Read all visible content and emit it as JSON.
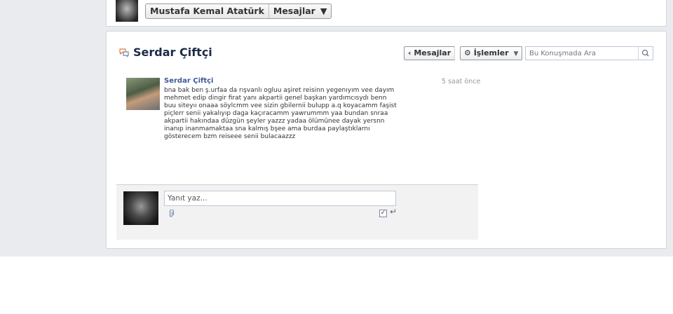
{
  "header": {
    "user_name": "Mustafa Kemal Atatürk",
    "messages_menu": "Mesajlar",
    "messages_caret": "▼"
  },
  "conversation": {
    "title": "Serdar Çiftçi",
    "back_button": "‹ Mesajlar",
    "actions_button": "⚙ İşlemler",
    "actions_caret": "▼",
    "search_placeholder": "Bu Konuşmada Ara"
  },
  "message": {
    "author": "Serdar Çiftçi",
    "time": "5 saat önce",
    "lines": [
      "bna bak ben ş.urfaa da rışvanlı ogluu aşiret reisinn yegenıyım vee dayım",
      "mehmet edip dingir firat yanı akpartii genel başkan yardımcısydı benn",
      "buu siteyıı onaaa söylcmm vee sizin gbilernii bulupp a.q koyacamm faşist",
      "piçlerr senii yakalıyıp daga kaçıracamm yawrummm yaa bundan snraa",
      "akpartii hakındaa düzgün şeyler yazzz yadaa ölümünee dayak yersnn",
      "inanıp inanmamaktaa sna kalmış bşee ama burdaa paylaştıklarnı",
      "gösterecem bzm reiseee senii bulacaazzz"
    ]
  },
  "reply": {
    "placeholder": "Yanıt yaz...",
    "enter_symbol": "↵",
    "check_mark": "✓"
  },
  "colors": {
    "accent": "#3b5998",
    "title": "#1c2a47",
    "background": "#e9ebee"
  }
}
